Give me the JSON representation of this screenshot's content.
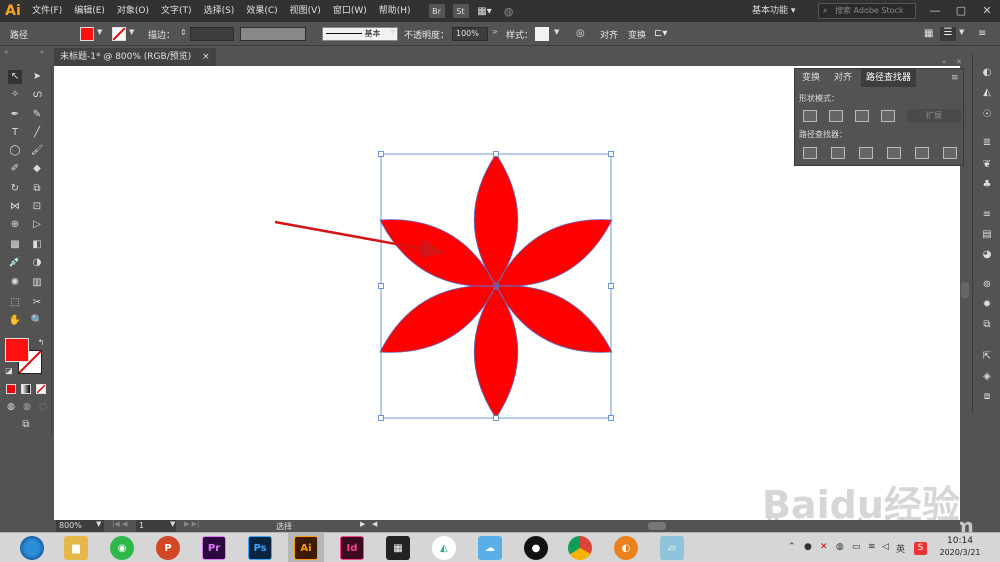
{
  "app": {
    "logo": "Ai"
  },
  "menu": [
    "文件(F)",
    "编辑(E)",
    "对象(O)",
    "文字(T)",
    "选择(S)",
    "效果(C)",
    "视图(V)",
    "窗口(W)",
    "帮助(H)"
  ],
  "menu_apps": [
    "Br",
    "St"
  ],
  "workspace": "基本功能",
  "stock_search": {
    "placeholder": "搜索 Adobe Stock"
  },
  "control": {
    "selection_label": "路径",
    "fill_color": "#ff1010",
    "stroke_label": "描边：",
    "stroke_style": "基本",
    "opacity_label": "不透明度：",
    "opacity_value": "100%",
    "style_label": "样式：",
    "align_label": "对齐",
    "transform_label": "变换"
  },
  "document_tab": {
    "title": "未标题-1* @ 800% (RGB/预览)",
    "close": "×"
  },
  "pathfinder": {
    "tabs": [
      "变换",
      "对齐",
      "路径查找器"
    ],
    "active_tab": "路径查找器",
    "shape_modes_label": "形状模式：",
    "pathfinders_label": "路径查找器：",
    "expand_label": "扩展"
  },
  "artwork": {
    "flower_fill": "#ff0000",
    "bbox_color": "#4a7fc8",
    "path_stroke": "#6a6ac0",
    "arrow_color": "#d41515"
  },
  "status": {
    "zoom": "800%",
    "page": "1",
    "tool": "选择"
  },
  "taskbar": {
    "apps": [
      {
        "label": "Pr",
        "color": "#2b0a3d",
        "fg": "#e07aff"
      },
      {
        "label": "Ps",
        "color": "#0a2340",
        "fg": "#31a8ff"
      },
      {
        "label": "Ai",
        "color": "#3b1b02",
        "fg": "#ff9a00"
      },
      {
        "label": "Id",
        "color": "#3b0a1c",
        "fg": "#ff3f94"
      }
    ],
    "time": "10:14",
    "date": "2020/3/21",
    "ime": "英"
  },
  "watermark": {
    "brand": "Baidu经验",
    "url": "jingyan.baidu.com"
  },
  "colors": {
    "ui_dark": "#323232",
    "ui_mid": "#535353",
    "canvas": "#ffffff"
  }
}
